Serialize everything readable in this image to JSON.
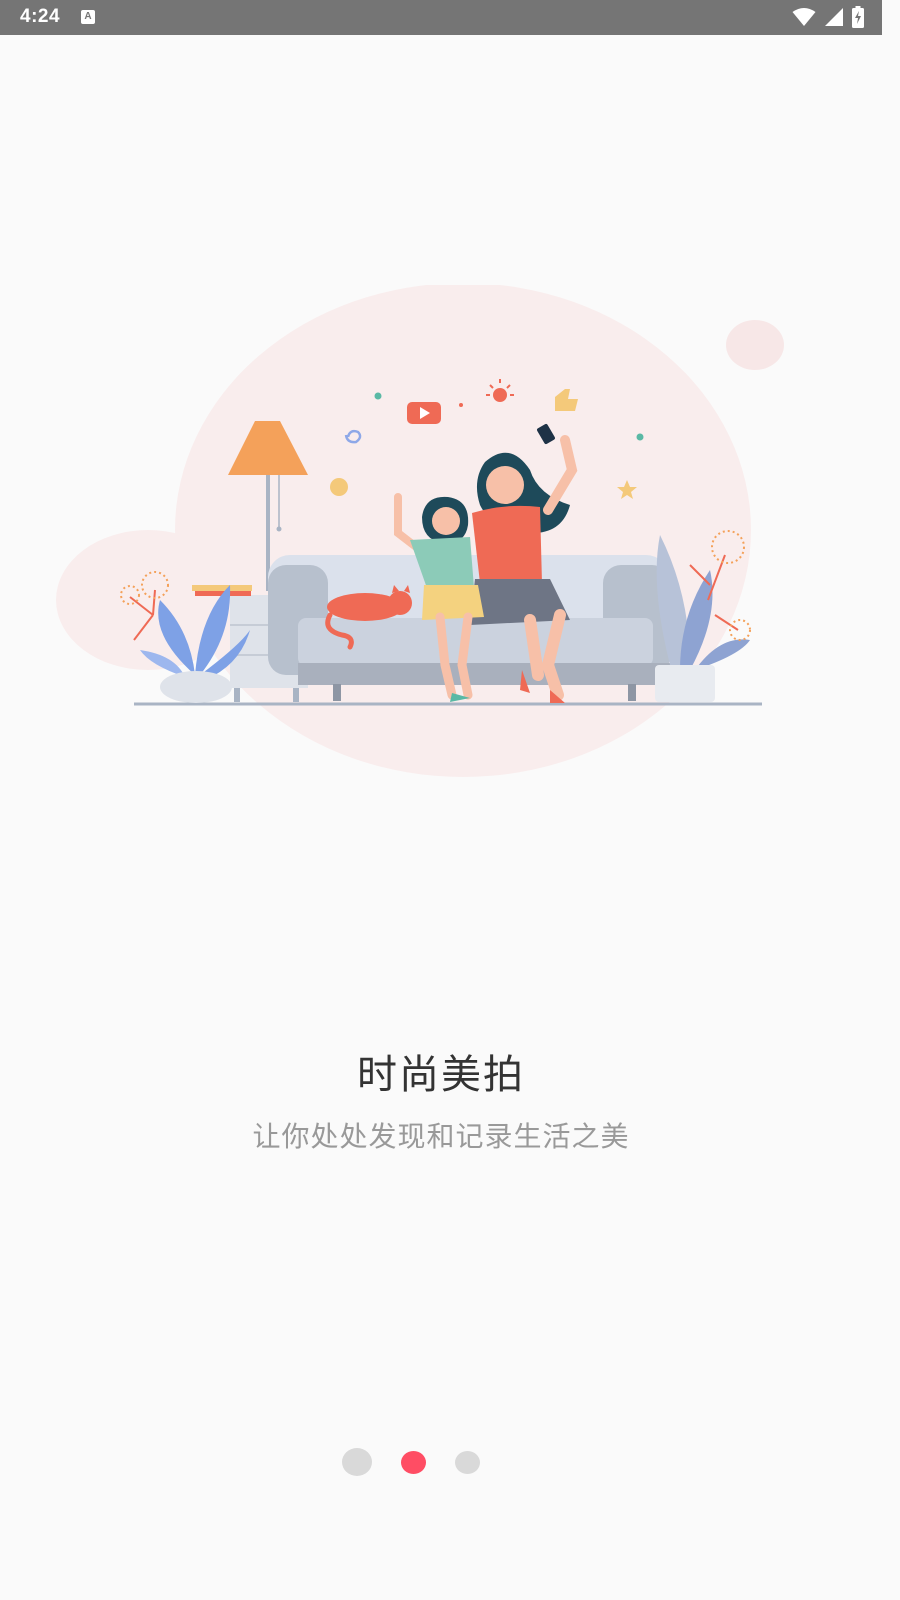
{
  "status_bar": {
    "time": "4:24",
    "notification_icon": "A",
    "icons": [
      "wifi-icon",
      "cell-signal-icon",
      "battery-charging-icon"
    ],
    "color": "#757575"
  },
  "onboarding": {
    "title": "时尚美拍",
    "subtitle": "让你处处发现和记录生活之美",
    "pager": {
      "page_count": 3,
      "active_page": 2,
      "active_color": "#ff4d64",
      "inactive_color": "#d9d9d9"
    }
  }
}
